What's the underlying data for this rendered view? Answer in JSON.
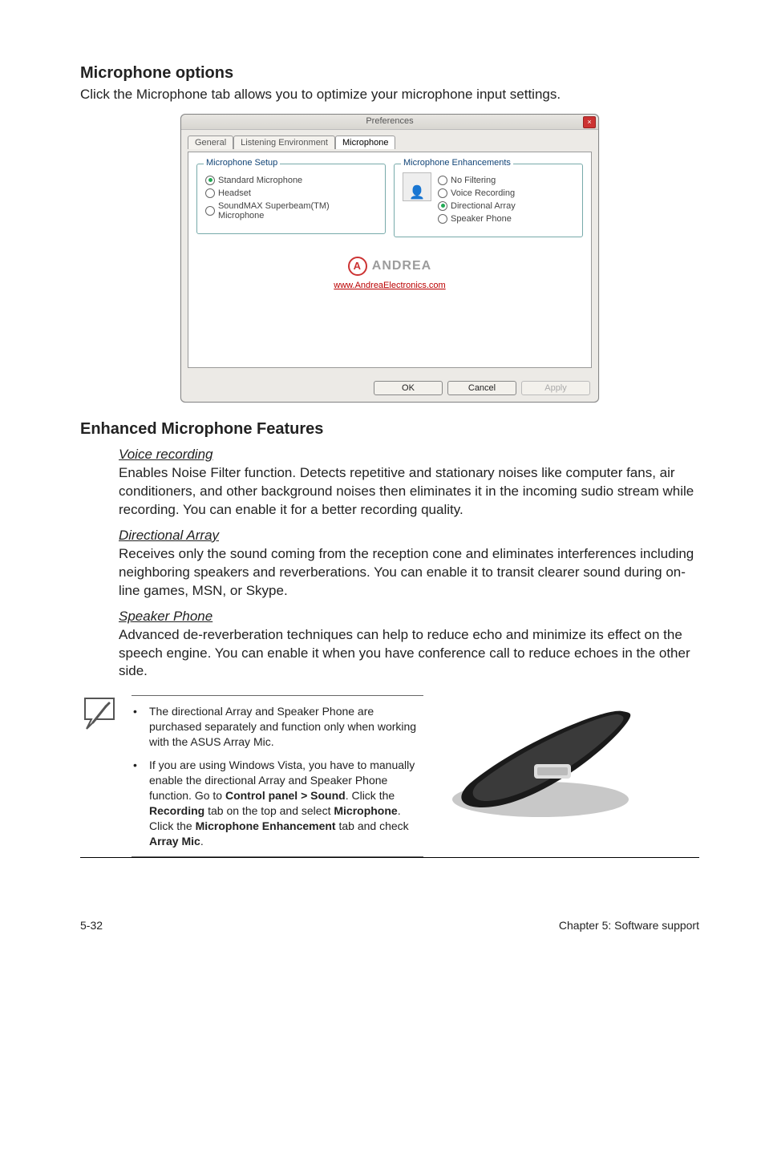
{
  "section1": {
    "heading": "Microphone options",
    "intro": "Click the Microphone tab allows you to optimize your microphone input settings."
  },
  "dialog": {
    "title": "Preferences",
    "close_glyph": "×",
    "tabs": {
      "general": "General",
      "listening": "Listening Environment",
      "microphone": "Microphone"
    },
    "group_setup_legend": "Microphone Setup",
    "setup_options": {
      "standard": "Standard Microphone",
      "headset": "Headset",
      "superbeam": "SoundMAX Superbeam(TM) Microphone"
    },
    "group_enh_legend": "Microphone Enhancements",
    "enh_options": {
      "nofilter": "No Filtering",
      "voicerec": "Voice Recording",
      "directional": "Directional Array",
      "speaker": "Speaker Phone"
    },
    "logo_text": "ANDREA",
    "logo_link": "www.AndreaElectronics.com",
    "buttons": {
      "ok": "OK",
      "cancel": "Cancel",
      "apply": "Apply"
    }
  },
  "section2": {
    "heading": "Enhanced Microphone Features",
    "features": {
      "voice": {
        "title": "Voice recording",
        "body": "Enables Noise Filter function. Detects repetitive and stationary noises like computer fans, air conditioners, and other background noises then eliminates it in the incoming sudio stream while recording. You can enable it for a better recording quality."
      },
      "array": {
        "title": "Directional Array",
        "body": "Receives only the sound coming from the reception cone and eliminates interferences including neighboring speakers and reverberations. You can enable it to transit clearer sound during on-line games, MSN, or Skype."
      },
      "phone": {
        "title": "Speaker Phone",
        "body": "Advanced de-reverberation techniques can help to reduce echo and minimize its effect on the speech engine. You can enable it when you have conference call to reduce echoes in the other side."
      }
    }
  },
  "notes": {
    "n1": "The directional Array and Speaker Phone are purchased separately and function only when working with the ASUS Array Mic.",
    "n2_pre": "If you are using Windows Vista, you have to manually enable the directional Array and Speaker Phone function. Go to ",
    "n2_b1": "Control panel > Sound",
    "n2_mid1": ". Click the ",
    "n2_b2": "Recording",
    "n2_mid2": " tab on the top and select ",
    "n2_b3": "Microphone",
    "n2_mid3": ". Click the ",
    "n2_b4": "Microphone Enhancement",
    "n2_mid4": " tab and check ",
    "n2_b5": "Array Mic",
    "n2_post": "."
  },
  "footer": {
    "left": "5-32",
    "right": "Chapter 5: Software support"
  }
}
